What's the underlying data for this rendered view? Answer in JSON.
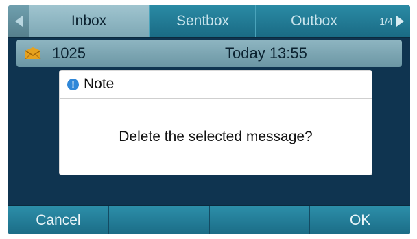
{
  "tabs": {
    "items": [
      {
        "label": "Inbox",
        "active": true
      },
      {
        "label": "Sentbox",
        "active": false
      },
      {
        "label": "Outbox",
        "active": false
      }
    ],
    "page_indicator": "1/4",
    "prev_arrow_icon": "triangle-left-icon",
    "next_arrow_icon": "triangle-right-icon"
  },
  "message": {
    "icon": "envelope-icon",
    "number": "1025",
    "time": "Today 13:55"
  },
  "dialog": {
    "icon": "info-icon",
    "icon_glyph": "!",
    "title": "Note",
    "message": "Delete the selected message?"
  },
  "softkeys": [
    "Cancel",
    "",
    "",
    "OK"
  ],
  "colors": {
    "screen_bg": "#0f3450",
    "tab_active": "#8fb6c2",
    "accent": "#1f7f9b",
    "dialog_bg": "#ffffff",
    "info_icon": "#2f87d8",
    "envelope": "#e6a21f"
  }
}
